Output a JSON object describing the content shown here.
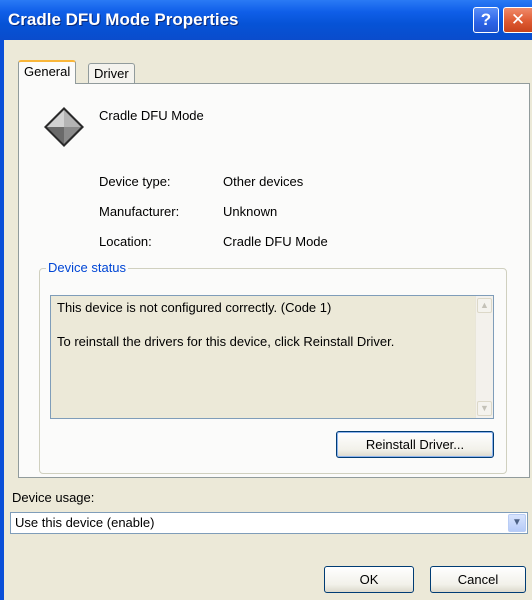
{
  "window": {
    "title": "Cradle DFU Mode  Properties",
    "help_glyph": "?",
    "close_glyph": "✕"
  },
  "tabs": [
    {
      "label": "General",
      "selected": true
    },
    {
      "label": "Driver",
      "selected": false
    }
  ],
  "general": {
    "device_name": "Cradle DFU Mode",
    "icon": "unknown-device-diamond-icon",
    "properties": [
      {
        "label": "Device type:",
        "value": "Other devices"
      },
      {
        "label": "Manufacturer:",
        "value": "Unknown"
      },
      {
        "label": "Location:",
        "value": "Cradle DFU Mode"
      }
    ],
    "status_group": {
      "title": "Device status",
      "lines": [
        "This device is not configured correctly. (Code 1)",
        "To reinstall the drivers for this device, click Reinstall Driver."
      ],
      "reinstall_label": "Reinstall Driver..."
    },
    "usage": {
      "label": "Device usage:",
      "selected": "Use this device (enable)"
    }
  },
  "footer": {
    "ok_label": "OK",
    "cancel_label": "Cancel"
  },
  "colors": {
    "title_bar": "#0a4fd8",
    "group_title": "#0046d5",
    "dialog_bg": "#ece9d8",
    "selected_tab_accent": "#f9b639"
  }
}
